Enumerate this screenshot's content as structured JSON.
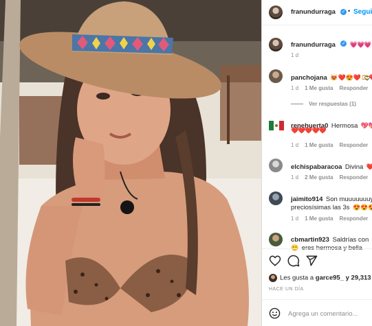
{
  "post": {
    "author": "franundurraga",
    "follow_label": "Seguir",
    "caption_hearts": "💗💗💗",
    "caption_age": "1 d"
  },
  "comments": [
    {
      "user": "panchojana",
      "text": "😻❤️😍❤️🎞❤️😊",
      "age": "1 d",
      "likes": "1 Me gusta",
      "reply": "Responder",
      "view_replies": "Ver respuestas (1)"
    },
    {
      "user": "renehuerta0",
      "text": "Hermosa",
      "text_emoji": "💖💖",
      "line2": "❤️❤️❤️❤️❤️",
      "age": "1 d",
      "likes": "1 Me gusta",
      "reply": "Responder"
    },
    {
      "user": "elchispabaracoa",
      "text": "Divina",
      "text_emoji": "❤️",
      "age": "1 d",
      "likes": "2 Me gusta",
      "reply": "Responder"
    },
    {
      "user": "jaimito914",
      "text": "Son muuuuuuuy",
      "line2": "preciosísimas las 3s",
      "line2_emoji": "😍😍😍",
      "age": "1 d",
      "likes": "1 Me gusta",
      "reply": "Responder"
    },
    {
      "user": "cbmartin923",
      "text": "Saldrías con",
      "line2": "eres hermosa y bella",
      "line2_emoji": "😊"
    }
  ],
  "likes": {
    "prefix": "Les gusta a ",
    "user": "garce95_",
    "suffix": " y 29,313"
  },
  "date": "HACE UN DÍA",
  "comment_input": {
    "placeholder": "Agrega un comentario..."
  },
  "icons": [
    "verified-badge",
    "heart-icon",
    "comment-icon",
    "share-icon",
    "emoji-icon",
    "like-comment-icon"
  ]
}
